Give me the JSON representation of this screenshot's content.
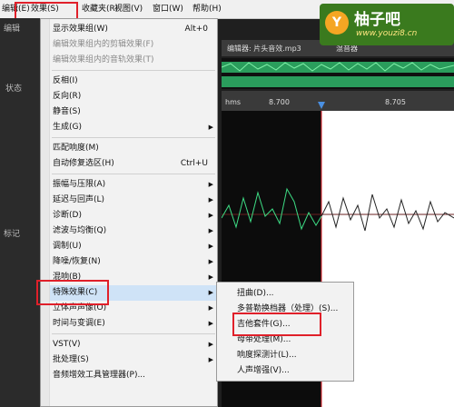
{
  "menubar": {
    "items": [
      "编辑(E)",
      "效果(S)",
      "收藏夹(R)",
      "视图(V)",
      "窗口(W)",
      "帮助(H)"
    ]
  },
  "left_panel": {
    "tab1": "编辑",
    "tab2": "状态",
    "tab3": "标记"
  },
  "editor": {
    "tab_title": "编辑器: 片头音效.mp3",
    "tab2": "混音器",
    "ruler_unit": "hms",
    "ruler_ticks": [
      "8.700",
      "8.705"
    ]
  },
  "effects_menu": {
    "items": [
      {
        "label": "显示效果组(W)",
        "shortcut": "Alt+0",
        "disabled": false
      },
      {
        "label": "编辑效果组内的剪辑效果(F)",
        "disabled": true
      },
      {
        "label": "编辑效果组内的音轨效果(T)",
        "disabled": true
      },
      {
        "label": "反相(I)"
      },
      {
        "label": "反向(R)"
      },
      {
        "label": "静音(S)"
      },
      {
        "label": "生成(G)",
        "submenu": true
      },
      {
        "label": "匹配响度(M)"
      },
      {
        "label": "自动修复选区(H)",
        "shortcut": "Ctrl+U"
      },
      {
        "label": "振幅与压限(A)",
        "submenu": true
      },
      {
        "label": "延迟与回声(L)",
        "submenu": true
      },
      {
        "label": "诊断(D)",
        "submenu": true
      },
      {
        "label": "滤波与均衡(Q)",
        "submenu": true
      },
      {
        "label": "调制(U)",
        "submenu": true
      },
      {
        "label": "降噪/恢复(N)",
        "submenu": true
      },
      {
        "label": "混响(B)",
        "submenu": true
      },
      {
        "label": "特殊效果(C)",
        "submenu": true,
        "highlighted": true
      },
      {
        "label": "立体声声像(O)",
        "submenu": true
      },
      {
        "label": "时间与变调(E)",
        "submenu": true
      },
      {
        "label": "VST(V)",
        "submenu": true
      },
      {
        "label": "批处理(S)",
        "submenu": true
      },
      {
        "label": "音频增效工具管理器(P)..."
      }
    ]
  },
  "special_submenu": {
    "items": [
      "扭曲(D)...",
      "多普勒换档器（处理）(S)...",
      "吉他套件(G)...",
      "母带处理(M)...",
      "响度探测计(L)...",
      "人声增强(V)..."
    ]
  },
  "watermark": {
    "logo": "Y",
    "title": "柚子吧",
    "url": "www.youzi8.cn"
  },
  "colors": {
    "accent_red": "#e0202a",
    "wave_green": "#3ddc84",
    "playhead_blue": "#4a90e2"
  }
}
